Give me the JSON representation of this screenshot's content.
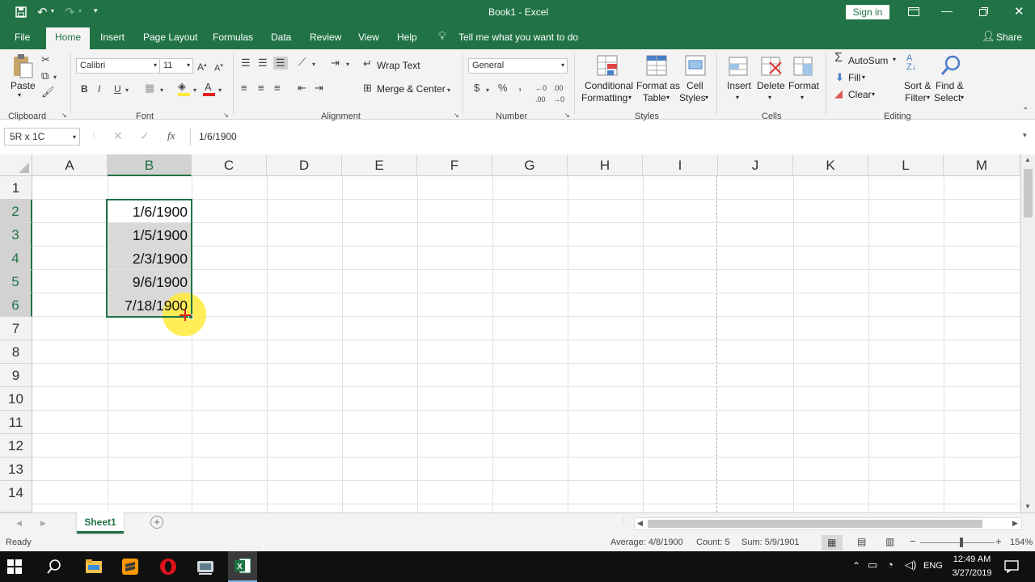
{
  "title": {
    "document": "Book1 - Excel",
    "sign_in": "Sign in"
  },
  "tabs": [
    "File",
    "Home",
    "Insert",
    "Page Layout",
    "Formulas",
    "Data",
    "Review",
    "View",
    "Help"
  ],
  "tell_me": "Tell me what you want to do",
  "share": "Share",
  "ribbon": {
    "clipboard": {
      "paste": "Paste",
      "group": "Clipboard"
    },
    "font": {
      "name": "Calibri",
      "size": "11",
      "bold": "B",
      "italic": "I",
      "underline": "U",
      "group": "Font"
    },
    "alignment": {
      "wrap_text": "Wrap Text",
      "merge_center": "Merge & Center",
      "group": "Alignment"
    },
    "number": {
      "format": "General",
      "currency": "$",
      "percent": "%",
      "comma": ",",
      "group": "Number"
    },
    "styles": {
      "conditional_1": "Conditional",
      "conditional_2": "Formatting",
      "format_as_1": "Format as",
      "format_as_2": "Table",
      "cell_styles_1": "Cell",
      "cell_styles_2": "Styles",
      "group": "Styles"
    },
    "cells": {
      "insert": "Insert",
      "delete": "Delete",
      "format": "Format",
      "group": "Cells"
    },
    "editing": {
      "autosum": "AutoSum",
      "fill": "Fill",
      "clear": "Clear",
      "sort_1": "Sort &",
      "sort_2": "Filter",
      "find_1": "Find &",
      "find_2": "Select",
      "group": "Editing"
    }
  },
  "formula_bar": {
    "name_box": "5R x 1C",
    "fx": "fx",
    "content": "1/6/1900"
  },
  "columns": [
    "A",
    "B",
    "C",
    "D",
    "E",
    "F",
    "G",
    "H",
    "I",
    "J",
    "K",
    "L",
    "M"
  ],
  "rows": [
    "1",
    "2",
    "3",
    "4",
    "5",
    "6",
    "7",
    "8",
    "9",
    "10",
    "11",
    "12",
    "13",
    "14"
  ],
  "cells": {
    "B2": "1/6/1900",
    "B3": "1/5/1900",
    "B4": "2/3/1900",
    "B5": "9/6/1900",
    "B6": "7/18/1900"
  },
  "sheet_tab": "Sheet1",
  "status": {
    "ready": "Ready",
    "average": "Average: 4/8/1900",
    "count": "Count: 5",
    "sum": "Sum: 5/9/1901",
    "zoom": "154%"
  },
  "taskbar": {
    "lang": "ENG",
    "time": "12:49 AM",
    "date": "3/27/2019"
  },
  "colors": {
    "excel_green": "#217346",
    "selection_fill": "#d9d9d9",
    "highlight": "#ffeb3b"
  }
}
